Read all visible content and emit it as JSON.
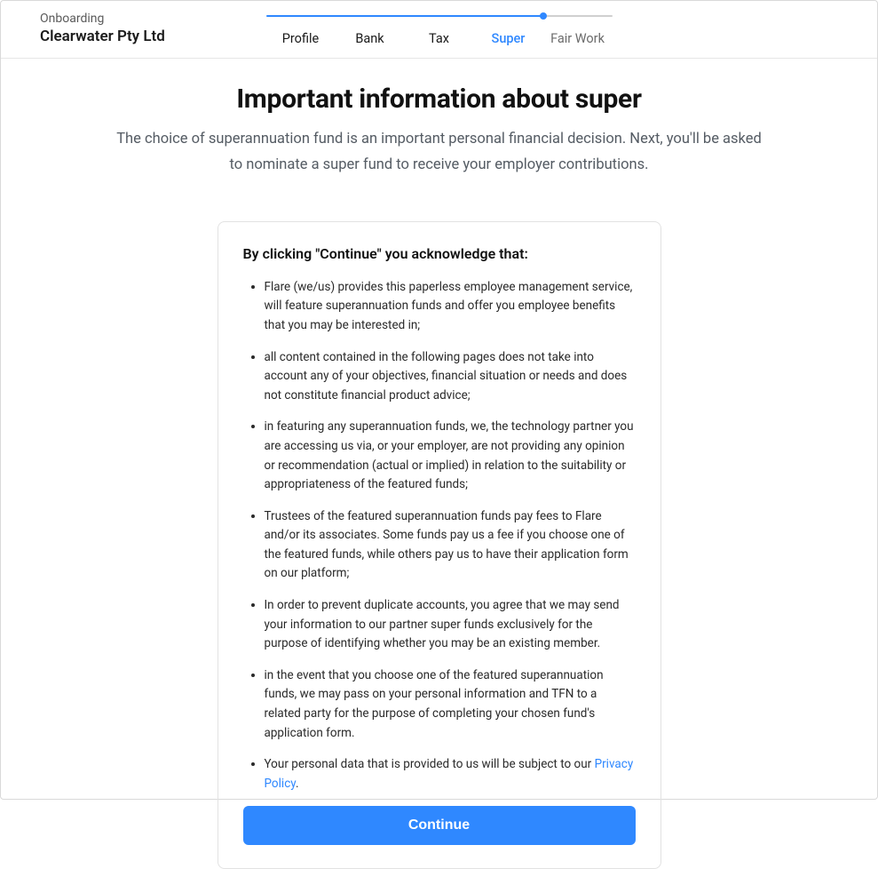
{
  "header": {
    "onboarding_label": "Onboarding",
    "company_name": "Clearwater Pty Ltd"
  },
  "stepper": {
    "steps": [
      {
        "label": "Profile",
        "state": "completed"
      },
      {
        "label": "Bank",
        "state": "completed"
      },
      {
        "label": "Tax",
        "state": "completed"
      },
      {
        "label": "Super",
        "state": "active"
      },
      {
        "label": "Fair Work",
        "state": "upcoming"
      }
    ]
  },
  "page": {
    "title": "Important information about super",
    "subtitle": "The choice of superannuation fund is an important personal financial decision. Next, you'll be asked to nominate a super fund to receive your employer contributions."
  },
  "card": {
    "heading": "By clicking \"Continue\" you acknowledge that:",
    "bullets": [
      "Flare (we/us) provides this paperless employee management service, will feature superannuation funds and offer you employee benefits that you may be interested in;",
      "all content contained in the following pages does not take into account any of your objectives, financial situation or needs and does not constitute financial product advice;",
      "in featuring any superannuation funds, we, the technology partner you are accessing us via, or your employer, are not providing any opinion or recommendation (actual or implied) in relation to the suitability or appropriateness of the featured funds;",
      "Trustees of the featured superannuation funds pay fees to Flare and/or its associates. Some funds pay us a fee if you choose one of the featured funds, while others pay us to have their application form on our platform;",
      "In order to prevent duplicate accounts, you agree that we may send your information to our partner super funds exclusively for the purpose of identifying whether you may be an existing member.",
      "in the event that you choose one of the featured superannuation funds, we may pass on your personal information and TFN to a related party for the purpose of completing your chosen fund's application form."
    ],
    "privacy_prefix": "Your personal data that is provided to us will be subject to our ",
    "privacy_link_text": "Privacy Policy",
    "privacy_suffix": ".",
    "continue_label": "Continue"
  }
}
